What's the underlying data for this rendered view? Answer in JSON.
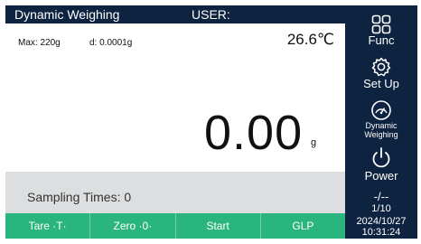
{
  "header": {
    "mode_title": "Dynamic Weighing",
    "user_label": "USER:"
  },
  "display": {
    "max_capacity": "Max: 220g",
    "readability": "d: 0.0001g",
    "temperature": "26.6℃",
    "weight_value": "0.00",
    "weight_unit": "g"
  },
  "sampling": {
    "label": "Sampling Times: 0"
  },
  "buttons": {
    "tare": "Tare ·T·",
    "zero": "Zero ·0·",
    "start": "Start",
    "glp": "GLP"
  },
  "sidebar": {
    "func_label": "Func",
    "setup_label": "Set Up",
    "dynamic_label_line1": "Dynamic",
    "dynamic_label_line2": "Weighing",
    "power_label": "Power",
    "page_dashes": "-/--",
    "page_indicator": "1/10",
    "date": "2024/10/27",
    "time": "10:31:24"
  },
  "colors": {
    "frame": "#0e2340",
    "button_bar": "#2bb57e",
    "sampling_bar": "#dcdedf"
  },
  "icons": [
    "grid-icon",
    "gear-icon",
    "gauge-icon",
    "power-icon"
  ]
}
